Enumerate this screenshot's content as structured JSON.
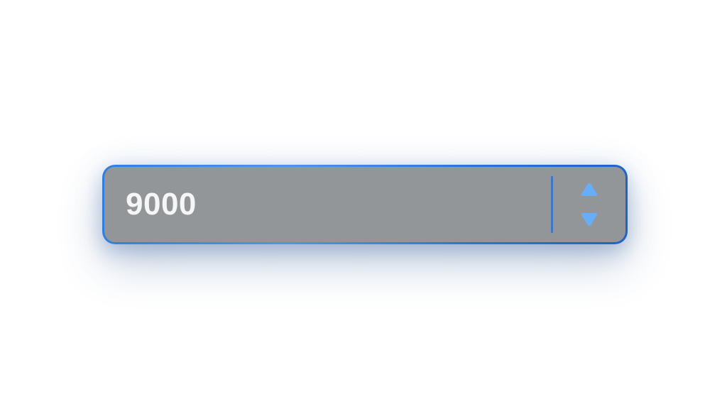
{
  "spinner": {
    "value": "9000",
    "increment_icon": "triangle-up",
    "decrement_icon": "triangle-down"
  },
  "colors": {
    "border_accent": "#2f7fe0",
    "field_background": "#939699",
    "value_text": "#f4f6f8",
    "divider": "#3d78c8",
    "arrow": "#66aef8"
  }
}
